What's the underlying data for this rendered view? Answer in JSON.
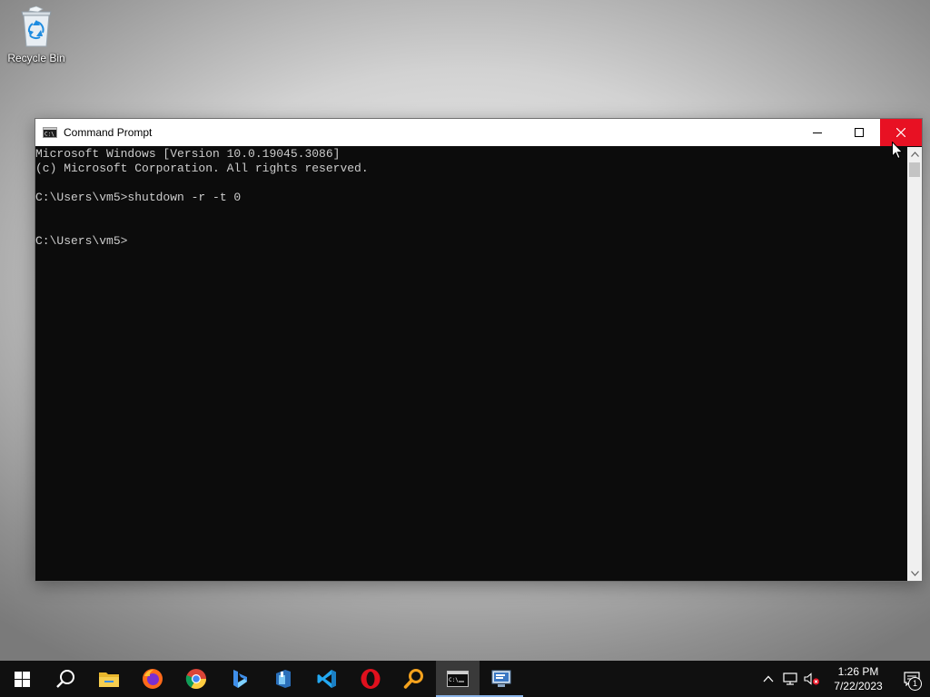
{
  "desktop": {
    "icons": [
      {
        "label": "Recycle Bin",
        "icon": "recycle-bin-icon"
      }
    ]
  },
  "window": {
    "title": "Command Prompt",
    "icon": "cmd-icon",
    "controls": [
      "minimize",
      "maximize",
      "close"
    ],
    "close_color": "#e81123",
    "console": {
      "background": "#0c0c0c",
      "foreground": "#cccccc",
      "lines": [
        "Microsoft Windows [Version 10.0.19045.3086]",
        "(c) Microsoft Corporation. All rights reserved.",
        "",
        "C:\\Users\\vm5>shutdown -r -t 0",
        "",
        "",
        "C:\\Users\\vm5>"
      ]
    }
  },
  "taskbar": {
    "items": [
      {
        "name": "start",
        "icon": "windows-logo-icon"
      },
      {
        "name": "search",
        "icon": "search-icon"
      },
      {
        "name": "file-explorer",
        "icon": "folder-icon"
      },
      {
        "name": "firefox",
        "icon": "firefox-icon"
      },
      {
        "name": "chrome",
        "icon": "chrome-icon"
      },
      {
        "name": "bing",
        "icon": "bing-icon"
      },
      {
        "name": "azure-data-studio",
        "icon": "azure-data-studio-icon"
      },
      {
        "name": "vscode",
        "icon": "vscode-icon"
      },
      {
        "name": "opera",
        "icon": "opera-icon"
      },
      {
        "name": "search-tool",
        "icon": "magnifier-app-icon"
      },
      {
        "name": "command-prompt",
        "icon": "cmd-icon",
        "active": true
      },
      {
        "name": "remote-desktop",
        "icon": "remote-desktop-icon",
        "running": true
      }
    ],
    "tray": {
      "icons": [
        "chevron-up-icon",
        "network-icon",
        "volume-muted-icon"
      ],
      "time": "1:26 PM",
      "date": "7/22/2023",
      "notification_count": "1"
    }
  }
}
